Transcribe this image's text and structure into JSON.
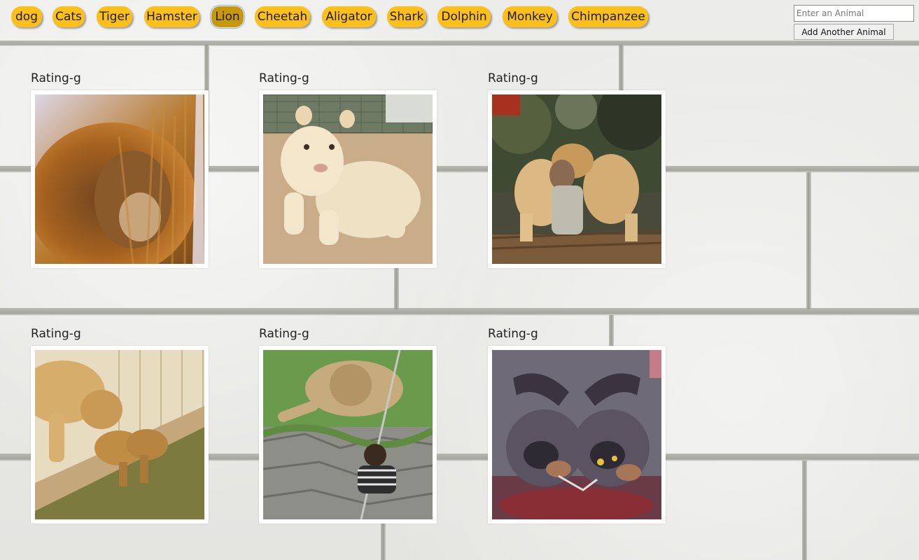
{
  "animal_buttons": [
    {
      "label": "dog"
    },
    {
      "label": "Cats"
    },
    {
      "label": "Tiger"
    },
    {
      "label": "Hamster"
    },
    {
      "label": "Lion",
      "active": true
    },
    {
      "label": "Cheetah"
    },
    {
      "label": "Aligator"
    },
    {
      "label": "Shark"
    },
    {
      "label": "Dolphin"
    },
    {
      "label": "Monkey"
    },
    {
      "label": "Chimpanzee"
    }
  ],
  "form": {
    "input_placeholder": "Enter an Animal",
    "input_value": "",
    "add_button_label": "Add Another Animal"
  },
  "gifs": [
    {
      "rating": "Rating-g",
      "image": "lion-closeup-in-grass"
    },
    {
      "rating": "Rating-g",
      "image": "white-lion-cub"
    },
    {
      "rating": "Rating-g",
      "image": "man-hugging-lions"
    },
    {
      "rating": "Rating-g",
      "image": "lioness-with-cubs-at-water"
    },
    {
      "rating": "Rating-g",
      "image": "lion-cub-and-child-at-glass"
    },
    {
      "rating": "Rating-g",
      "image": "cartoon-hyenas"
    }
  ],
  "colors": {
    "button_bg": "#fdc01a",
    "button_active_bg": "#c8980c",
    "wall": "#e9e9e7"
  }
}
